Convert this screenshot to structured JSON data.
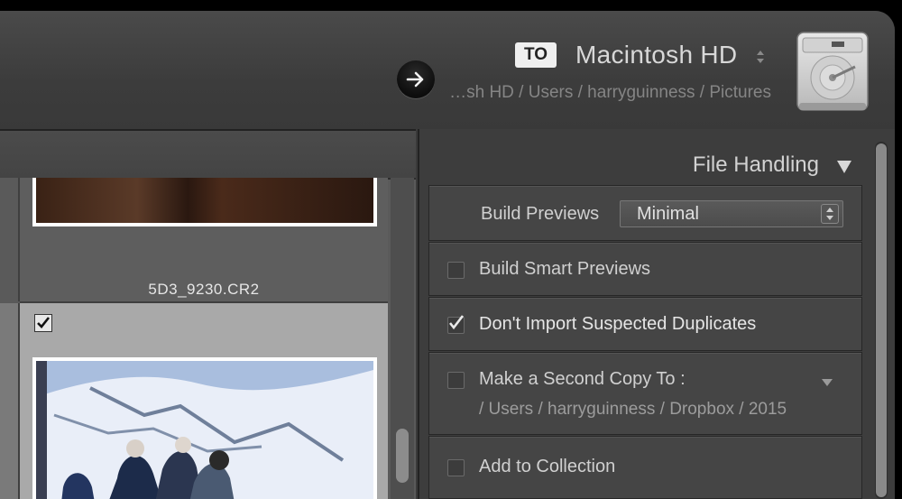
{
  "header": {
    "to_badge": "TO",
    "destination_title": "Macintosh HD",
    "destination_path": "…sh HD / Users / harryguinness / Pictures",
    "icons": {
      "import_arrow": "arrow-right-icon",
      "drive": "hard-drive-icon",
      "stepper": "up-down-arrows-icon"
    }
  },
  "grid": {
    "thumbnails": [
      {
        "filename": "5D3_9230.CR2",
        "checked": false
      },
      {
        "filename": "",
        "checked": true
      }
    ],
    "checkmark_glyph": "✔"
  },
  "panel": {
    "title": "File Handling",
    "build_previews": {
      "label": "Build Previews",
      "value": "Minimal"
    },
    "options": [
      {
        "label": "Build Smart Previews",
        "checked": false
      },
      {
        "label": "Don't Import Suspected Duplicates",
        "checked": true
      },
      {
        "label": "Make a Second Copy To :",
        "checked": false,
        "path": "/ Users / harryguinness / Dropbox / 2015"
      },
      {
        "label": "Add to Collection",
        "checked": false
      }
    ],
    "checkmark_glyph": "✔"
  },
  "colors": {
    "window_bg": "#3a3a3a",
    "header_text": "#d8d8d8",
    "path_text": "#858585",
    "row_bg": "#454545",
    "selected_thumb_bg": "#a9a9a9"
  }
}
